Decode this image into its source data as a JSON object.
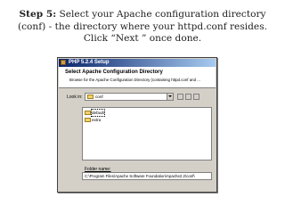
{
  "caption": {
    "step_label": "Step 5:",
    "line1_rest": " Select your Apache configuration directory",
    "line2": "(conf) - the directory where your httpd.conf resides.",
    "line3": "Click “Next ” once done."
  },
  "dialog": {
    "window_title": "PHP 5.2.4 Setup",
    "header_title": "Select Apache Configuration Directory",
    "header_description": "Browse for the Apache Configuration Directory (containing httpd.conf and ...",
    "look_in_label": "Look in:",
    "look_in_value": "conf",
    "folders": [
      {
        "label": "default"
      },
      {
        "label": "extra"
      }
    ],
    "folder_name_label": "Folder name:",
    "folder_name_value": "C:\\Program Files\\Apache Software Foundation\\Apache2.2\\conf\\"
  },
  "colors": {
    "titlebar": "#0a246a",
    "dialog_bg": "#d4d0c8",
    "folder": "#f2d26a"
  },
  "icons": [
    "folder-icon",
    "up-folder-icon",
    "new-folder-icon",
    "view-menu-icon",
    "dropdown-arrow-icon"
  ]
}
